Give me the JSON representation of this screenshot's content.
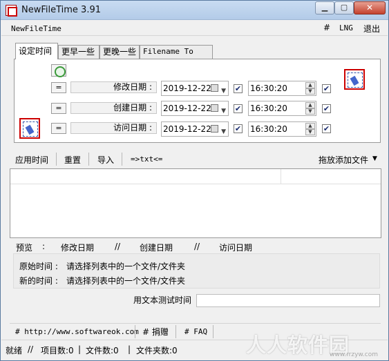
{
  "window": {
    "title": "NewFileTime 3.91"
  },
  "menu": {
    "app": "NewFileTime",
    "hash": "#",
    "lng": "LNG",
    "exit": "退出"
  },
  "tabs": [
    {
      "label": "设定时间"
    },
    {
      "label": "更早一些"
    },
    {
      "label": "更晚一些"
    },
    {
      "label": "Filename To Time"
    }
  ],
  "rows": [
    {
      "eq": "=",
      "label": "修改日期 :",
      "date": "2019-12-22",
      "date_checked": "✔",
      "time": "16:30:20",
      "time_checked": "✔"
    },
    {
      "eq": "=",
      "label": "创建日期 :",
      "date": "2019-12-22",
      "date_checked": "✔",
      "time": "16:30:20",
      "time_checked": "✔"
    },
    {
      "eq": "=",
      "label": "访问日期 :",
      "date": "2019-12-22",
      "date_checked": "✔",
      "time": "16:30:20",
      "time_checked": "✔"
    }
  ],
  "toolbar": {
    "apply": "应用时间",
    "reset": "重置",
    "import": "导入",
    "txt": "=>txt<=",
    "dragdrop": "拖放添加文件",
    "dragdrop_arrow": "▼"
  },
  "preview": {
    "label": "预览",
    "colon": ":",
    "modified": "修改日期",
    "sep": "//",
    "created": "创建日期",
    "accessed": "访问日期"
  },
  "info": {
    "original_label": "原始时间 :",
    "original_value": "请选择列表中的一个文件/文件夹",
    "new_label": "新的时间 :",
    "new_value": "请选择列表中的一个文件/文件夹"
  },
  "test": {
    "label": "用文本测试时间",
    "value": ""
  },
  "links": {
    "site": "# http://www.softwareok.com",
    "donate": "# 捐赠",
    "faq": "# FAQ"
  },
  "status": {
    "ready": "就绪",
    "sep1": "//",
    "items": "项目数:0",
    "files": "文件数:0",
    "folders": "文件夹数:0",
    "bar": "|"
  },
  "watermark": {
    "text": "人人软件园",
    "sub": "www.rrzyw.com"
  }
}
